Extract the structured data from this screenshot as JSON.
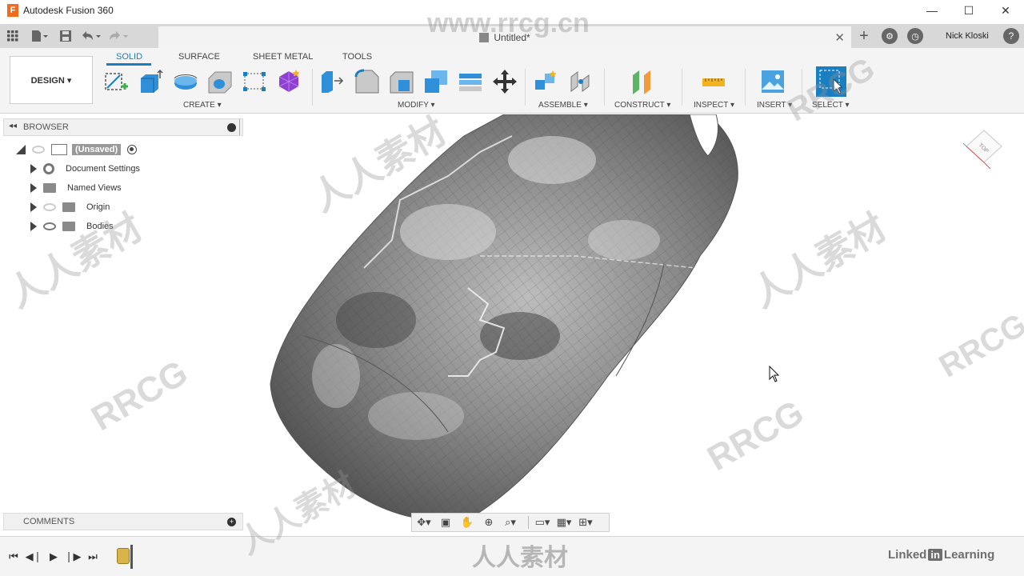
{
  "window": {
    "app_title": "Autodesk Fusion 360",
    "minimize": "—",
    "maximize": "☐",
    "close": "✕"
  },
  "document": {
    "tab_name": "Untitled*",
    "close": "✕"
  },
  "user": {
    "name": "Nick Kloski"
  },
  "toolbar": {
    "workspace": "DESIGN ▾",
    "tabs": [
      "SOLID",
      "SURFACE",
      "SHEET METAL",
      "TOOLS"
    ],
    "groups": [
      "CREATE ▾",
      "MODIFY ▾",
      "ASSEMBLE ▾",
      "CONSTRUCT ▾",
      "INSPECT ▾",
      "INSERT ▾",
      "SELECT ▾"
    ]
  },
  "browser": {
    "title": "BROWSER",
    "root": "(Unsaved)",
    "items": [
      {
        "label": "Document Settings"
      },
      {
        "label": "Named Views"
      },
      {
        "label": "Origin"
      },
      {
        "label": "Bodies"
      }
    ]
  },
  "comments": {
    "title": "COMMENTS"
  },
  "viewcube": {
    "face": "TOP"
  },
  "watermarks": {
    "site": "www.rrcg.cn",
    "brand": "RRCG",
    "cn": "人人素材",
    "linkedin_pre": "Linked",
    "linkedin_in": "in",
    "linkedin_post": "Learning"
  },
  "colors": {
    "accent": "#1a7fc1",
    "logo": "#f26b1d"
  }
}
